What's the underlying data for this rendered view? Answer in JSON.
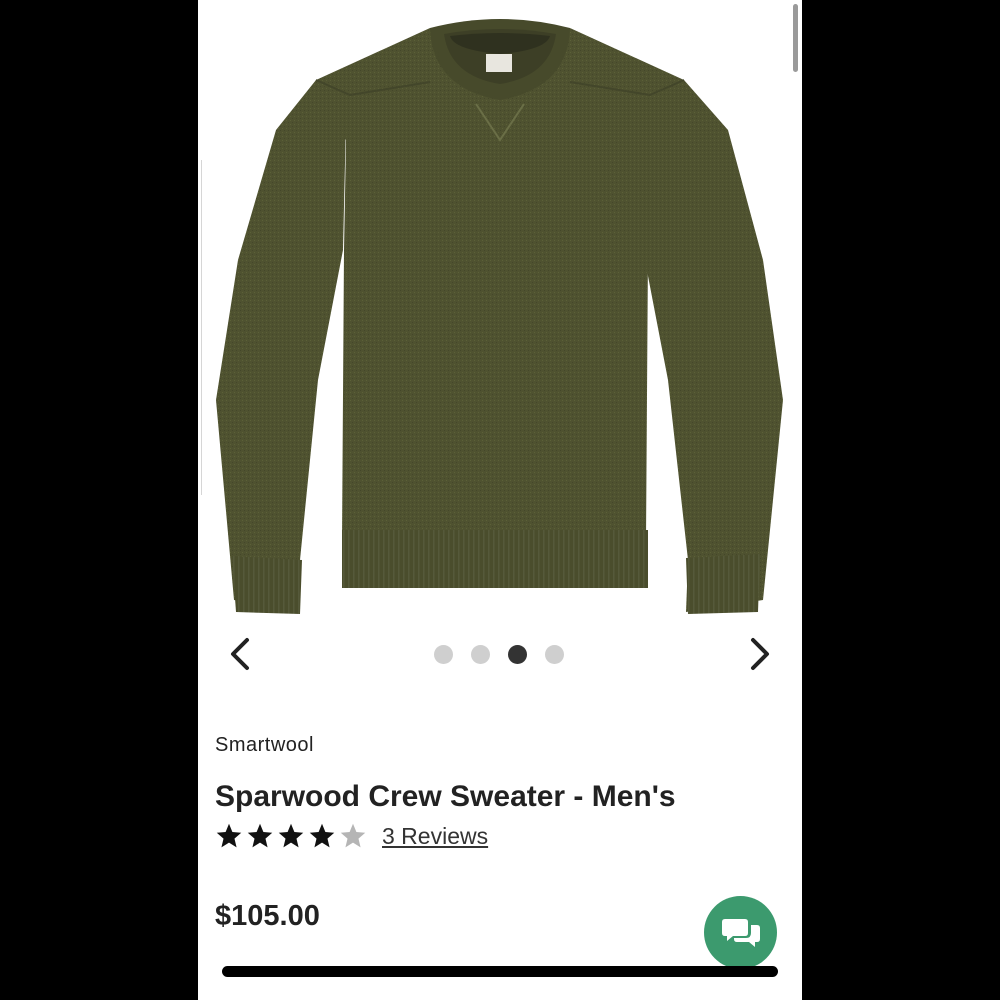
{
  "carousel": {
    "image_alt": "Sparwood Crew Sweater - Men's",
    "total_images": 4,
    "active_index": 2,
    "prev_icon": "chevron-left-icon",
    "next_icon": "chevron-right-icon"
  },
  "product": {
    "brand": "Smartwool",
    "title": "Sparwood Crew Sweater - Men's",
    "rating": 4,
    "rating_max": 5,
    "reviews_label": "3 Reviews",
    "price": "$105.00",
    "sweater_color": "#4f5230"
  },
  "chat": {
    "icon": "chat-bubbles-icon",
    "color": "#3c9a6e"
  }
}
